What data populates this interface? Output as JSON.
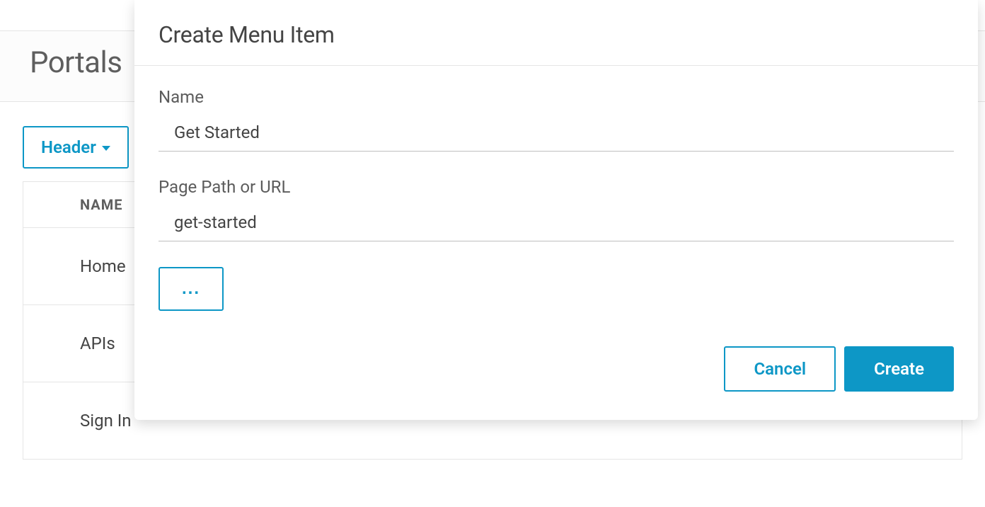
{
  "page": {
    "title": "Portals",
    "headerDropdown": "Header",
    "table": {
      "headers": [
        "NAME"
      ],
      "rows": [
        "Home",
        "APIs",
        "Sign In"
      ]
    }
  },
  "modal": {
    "title": "Create Menu Item",
    "fields": {
      "name": {
        "label": "Name",
        "value": "Get Started"
      },
      "path": {
        "label": "Page Path or URL",
        "value": "get-started"
      }
    },
    "moreLabel": "...",
    "cancelLabel": "Cancel",
    "createLabel": "Create"
  }
}
